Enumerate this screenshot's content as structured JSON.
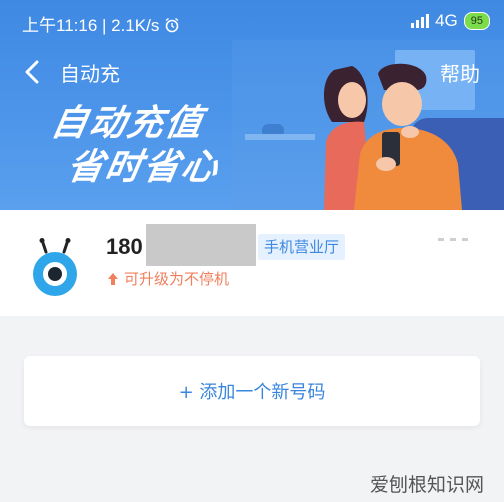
{
  "status_bar": {
    "time": "上午11:16",
    "speed": "2.1K/s",
    "network": "4G",
    "battery": "95"
  },
  "nav": {
    "title": "自动充",
    "help_label": "帮助"
  },
  "banner": {
    "slogan_line1": "自动充值",
    "slogan_line2": "省时省心"
  },
  "account": {
    "phone_prefix": "180",
    "badge": "手机营业厅",
    "upgrade_text": "可升级为不停机"
  },
  "add_number": {
    "label": "+ 添加一个新号码"
  },
  "watermark": "爱刨根知识网",
  "colors": {
    "banner_blue": "#4a92e7",
    "accent_blue": "#3a86dd",
    "upgrade_orange": "#f07f5d",
    "page_bg": "#f2f3f5"
  }
}
